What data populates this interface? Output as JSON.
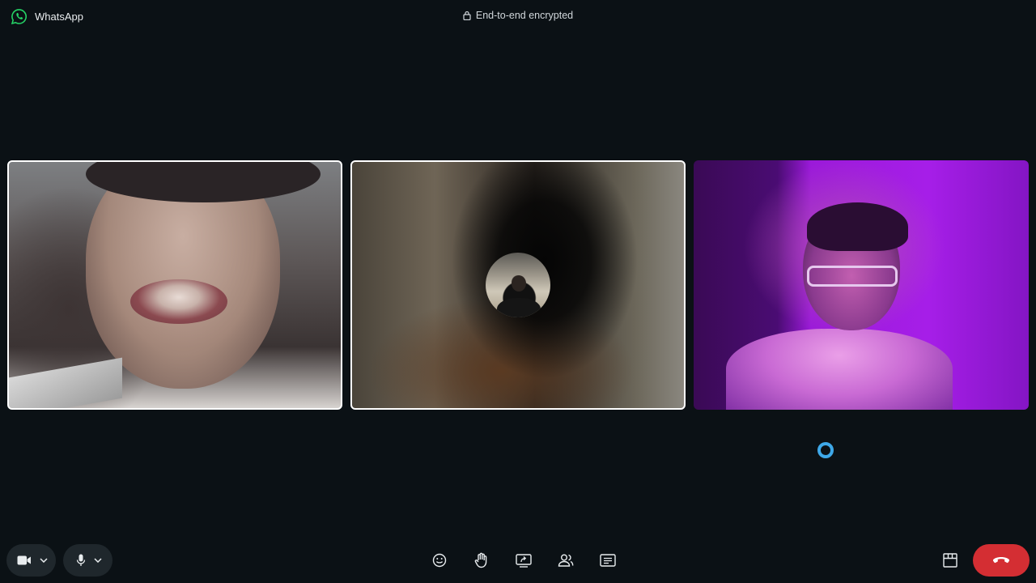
{
  "app": {
    "name": "WhatsApp",
    "encryption_status": "End-to-end encrypted"
  },
  "participants": [
    {
      "tile": 1,
      "video": "on",
      "selected": true
    },
    {
      "tile": 2,
      "video": "off",
      "avatar": "profile-photo",
      "selected": true
    },
    {
      "tile": 3,
      "video": "on",
      "selected": false
    }
  ],
  "colors": {
    "background": "#0b1115",
    "brand_green": "#25d366",
    "end_call_red": "#d42e33",
    "loading_blue": "#3ea8e8",
    "control_pill": "#1f272c"
  },
  "controls": {
    "left": [
      {
        "name": "camera",
        "icon": "video-camera-icon",
        "dropdown_icon": "chevron-down-icon"
      },
      {
        "name": "microphone",
        "icon": "microphone-icon",
        "dropdown_icon": "chevron-down-icon"
      }
    ],
    "center": [
      {
        "name": "reactions",
        "icon": "emoji-icon"
      },
      {
        "name": "raise-hand",
        "icon": "hand-icon"
      },
      {
        "name": "share-screen",
        "icon": "screen-share-icon"
      },
      {
        "name": "participants",
        "icon": "people-icon"
      },
      {
        "name": "chat",
        "icon": "chat-icon"
      }
    ],
    "right": [
      {
        "name": "layout",
        "icon": "layout-icon"
      },
      {
        "name": "end-call",
        "icon": "phone-hangup-icon"
      }
    ]
  }
}
